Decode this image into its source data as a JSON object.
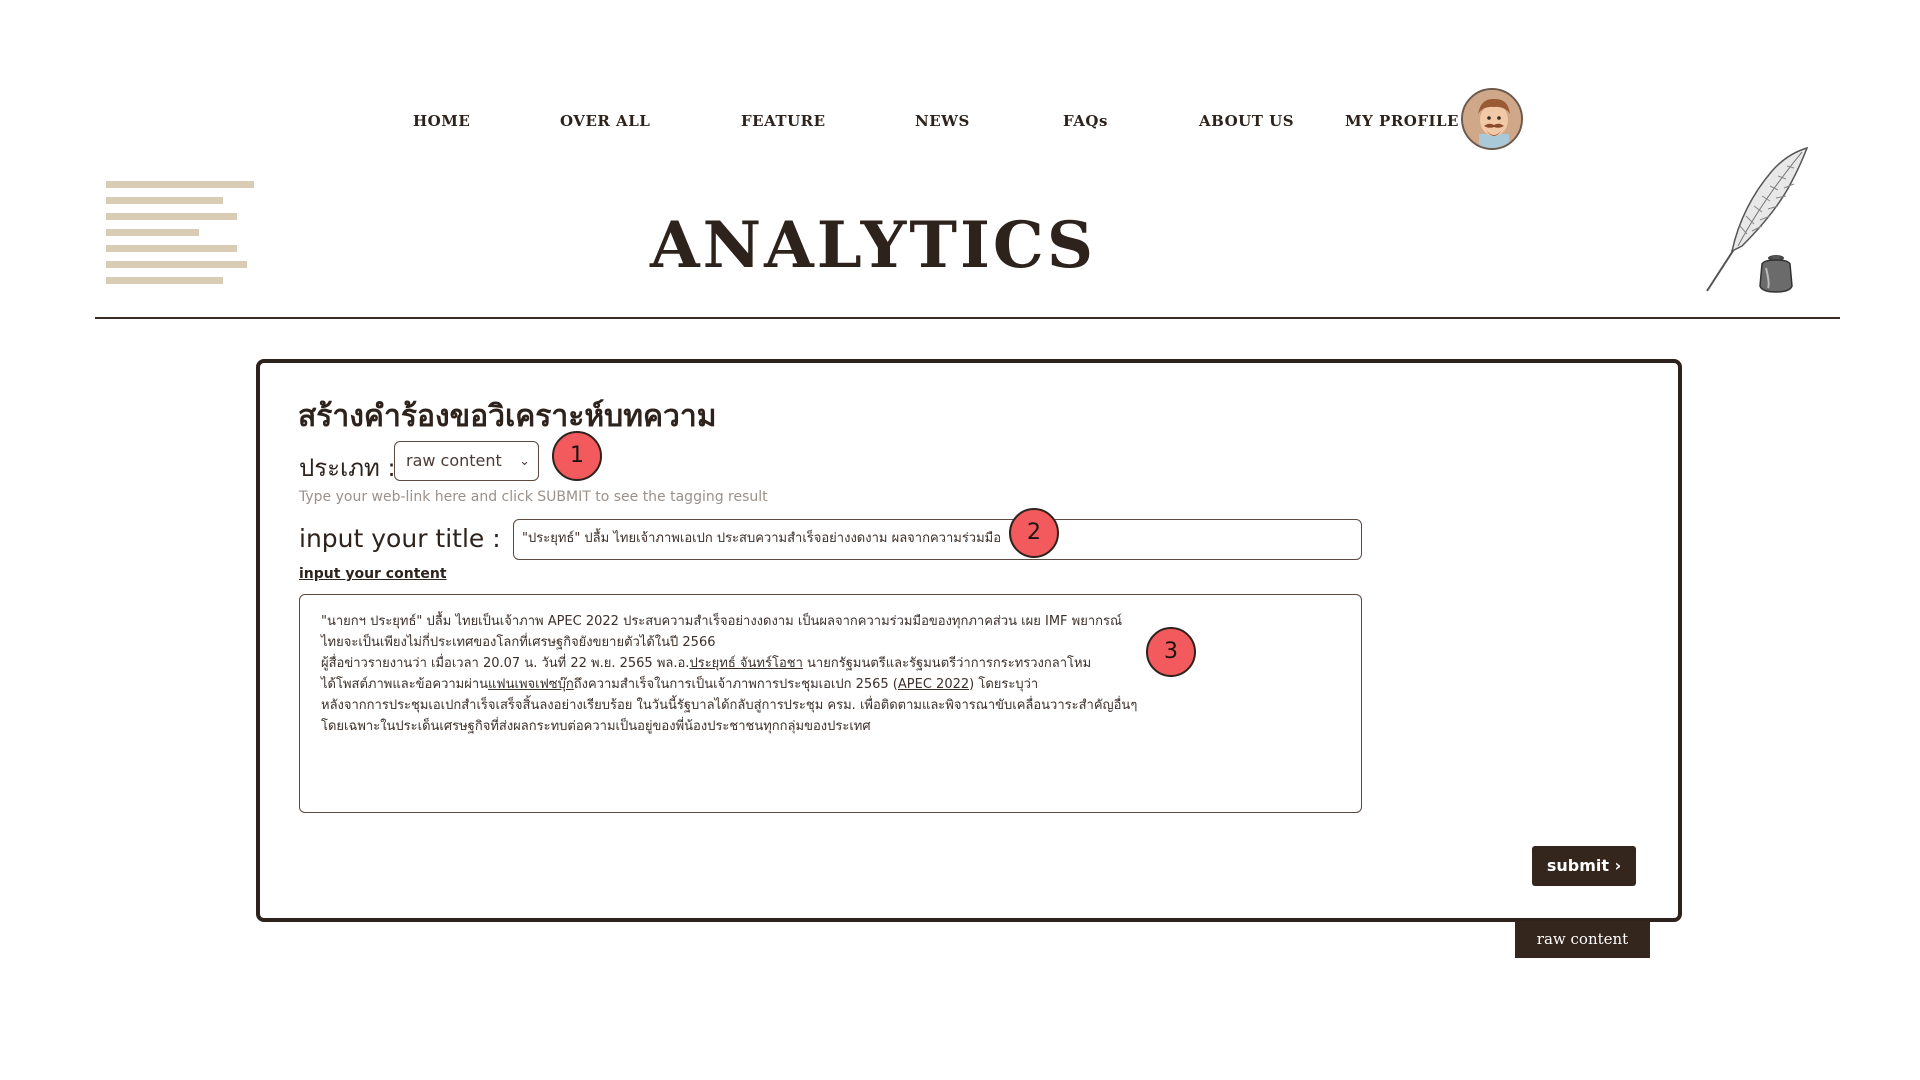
{
  "nav": {
    "items": [
      {
        "label": "HOME"
      },
      {
        "label": "OVER ALL"
      },
      {
        "label": "FEATURE"
      },
      {
        "label": "NEWS"
      },
      {
        "label": "FAQs"
      },
      {
        "label": "ABOUT US"
      },
      {
        "label": "MY PROFILE"
      }
    ]
  },
  "header": {
    "title": "ANALYTICS"
  },
  "form": {
    "heading": "สร้างคำร้องขอวิเคราะห์บทความ",
    "type_label": "ประเภท :",
    "type_selected": "raw content",
    "hint": "Type your web-link here and click SUBMIT to see the tagging result",
    "title_label": "input your title :",
    "title_value": "\"ประยุทธ์\" ปลื้ม ไทยเจ้าภาพเอเปก ประสบความสำเร็จอย่างงดงาม ผลจากความร่วมมือ",
    "content_label": "input your content",
    "content": {
      "line1": "\"นายกฯ ประยุทธ์\" ปลื้ม ไทยเป็นเจ้าภาพ APEC 2022 ประสบความสำเร็จอย่างงดงาม เป็นผลจากความร่วมมือของทุกภาคส่วน เผย IMF พยากรณ์",
      "line2": "ไทยจะเป็นเพียงไม่กี่ประเทศของโลกที่เศรษฐกิจยังขยายตัวได้ในปี 2566",
      "line3_pre": "ผู้สื่อข่าวรายงานว่า เมื่อเวลา 20.07 น. วันที่ 22 พ.ย. 2565 พล.อ.",
      "line3_link": "ประยุทธ์ จันทร์โอชา",
      "line3_post": " นายกรัฐมนตรีและรัฐมนตรีว่าการกระทรวงกลาโหม",
      "line4_pre": "ได้โพสต์ภาพและข้อความผ่าน",
      "line4_link1": "แฟนเพจเฟซบุ๊ก",
      "line4_mid": "ถึงความสำเร็จในการเป็นเจ้าภาพการประชุมเอเปก 2565 (",
      "line4_link2": "APEC 2022",
      "line4_post": ") โดยระบุว่า",
      "line5": "หลังจากการประชุมเอเปกสำเร็จเสร็จสิ้นลงอย่างเรียบร้อย ในวันนี้รัฐบาลได้กลับสู่การประชุม ครม. เพื่อติดตามและพิจารณาขับเคลื่อนวาระสำคัญอื่นๆ",
      "line6": "โดยเฉพาะในประเด็นเศรษฐกิจที่ส่งผลกระทบต่อความเป็นอยู่ของพี่น้องประชาชนทุกกลุ่มของประเทศ"
    },
    "submit_label": "submit ›",
    "tag_chip": "raw content"
  },
  "badges": [
    "1",
    "2",
    "3"
  ],
  "colors": {
    "primary_dark": "#34251d",
    "badge": "#f25a5d",
    "menu_lines": "#d8ccb4"
  },
  "icons": {
    "menu": "hamburger-lines-icon",
    "decor": "quill-inkwell-icon",
    "avatar": "profile-avatar"
  }
}
